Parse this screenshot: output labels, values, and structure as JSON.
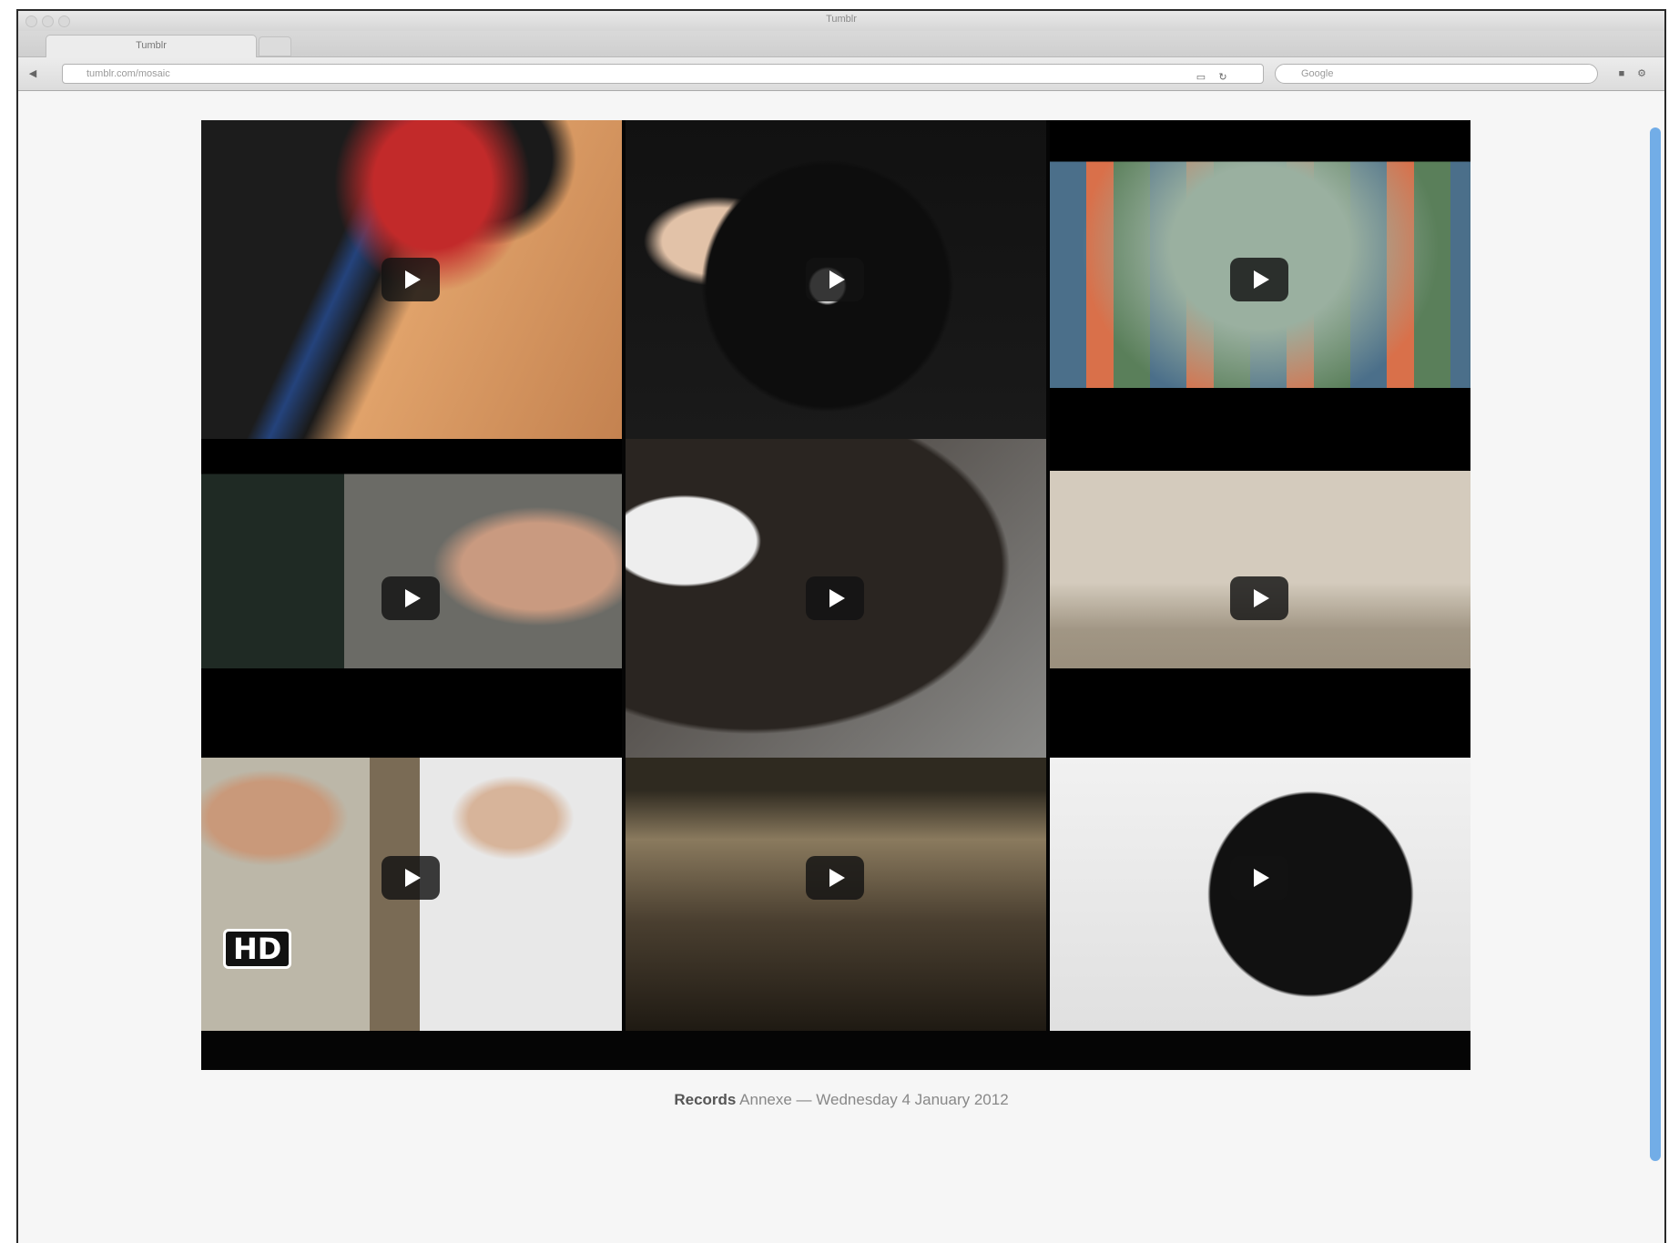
{
  "browser": {
    "window_title": "Tumblr",
    "tab_label": "Tumblr",
    "address": "tumblr.com/mosaic",
    "search_placeholder": "Google"
  },
  "grid": {
    "tiles": [
      {
        "id": "tile-1",
        "name": "record-stack-video"
      },
      {
        "id": "tile-2",
        "name": "turntable-hand-video"
      },
      {
        "id": "tile-3",
        "name": "record-art-video"
      },
      {
        "id": "tile-4",
        "name": "portrait-man-video"
      },
      {
        "id": "tile-5",
        "name": "vinyl-closeup-video"
      },
      {
        "id": "tile-6",
        "name": "turntable-side-video"
      },
      {
        "id": "tile-7",
        "name": "two-men-hd-video",
        "hd": "HD"
      },
      {
        "id": "tile-8",
        "name": "record-store-video"
      },
      {
        "id": "tile-9",
        "name": "vinyl-white-video"
      }
    ]
  },
  "caption": {
    "bold": "Records",
    "rest": " Annexe  —  Wednesday 4 January 2012"
  }
}
